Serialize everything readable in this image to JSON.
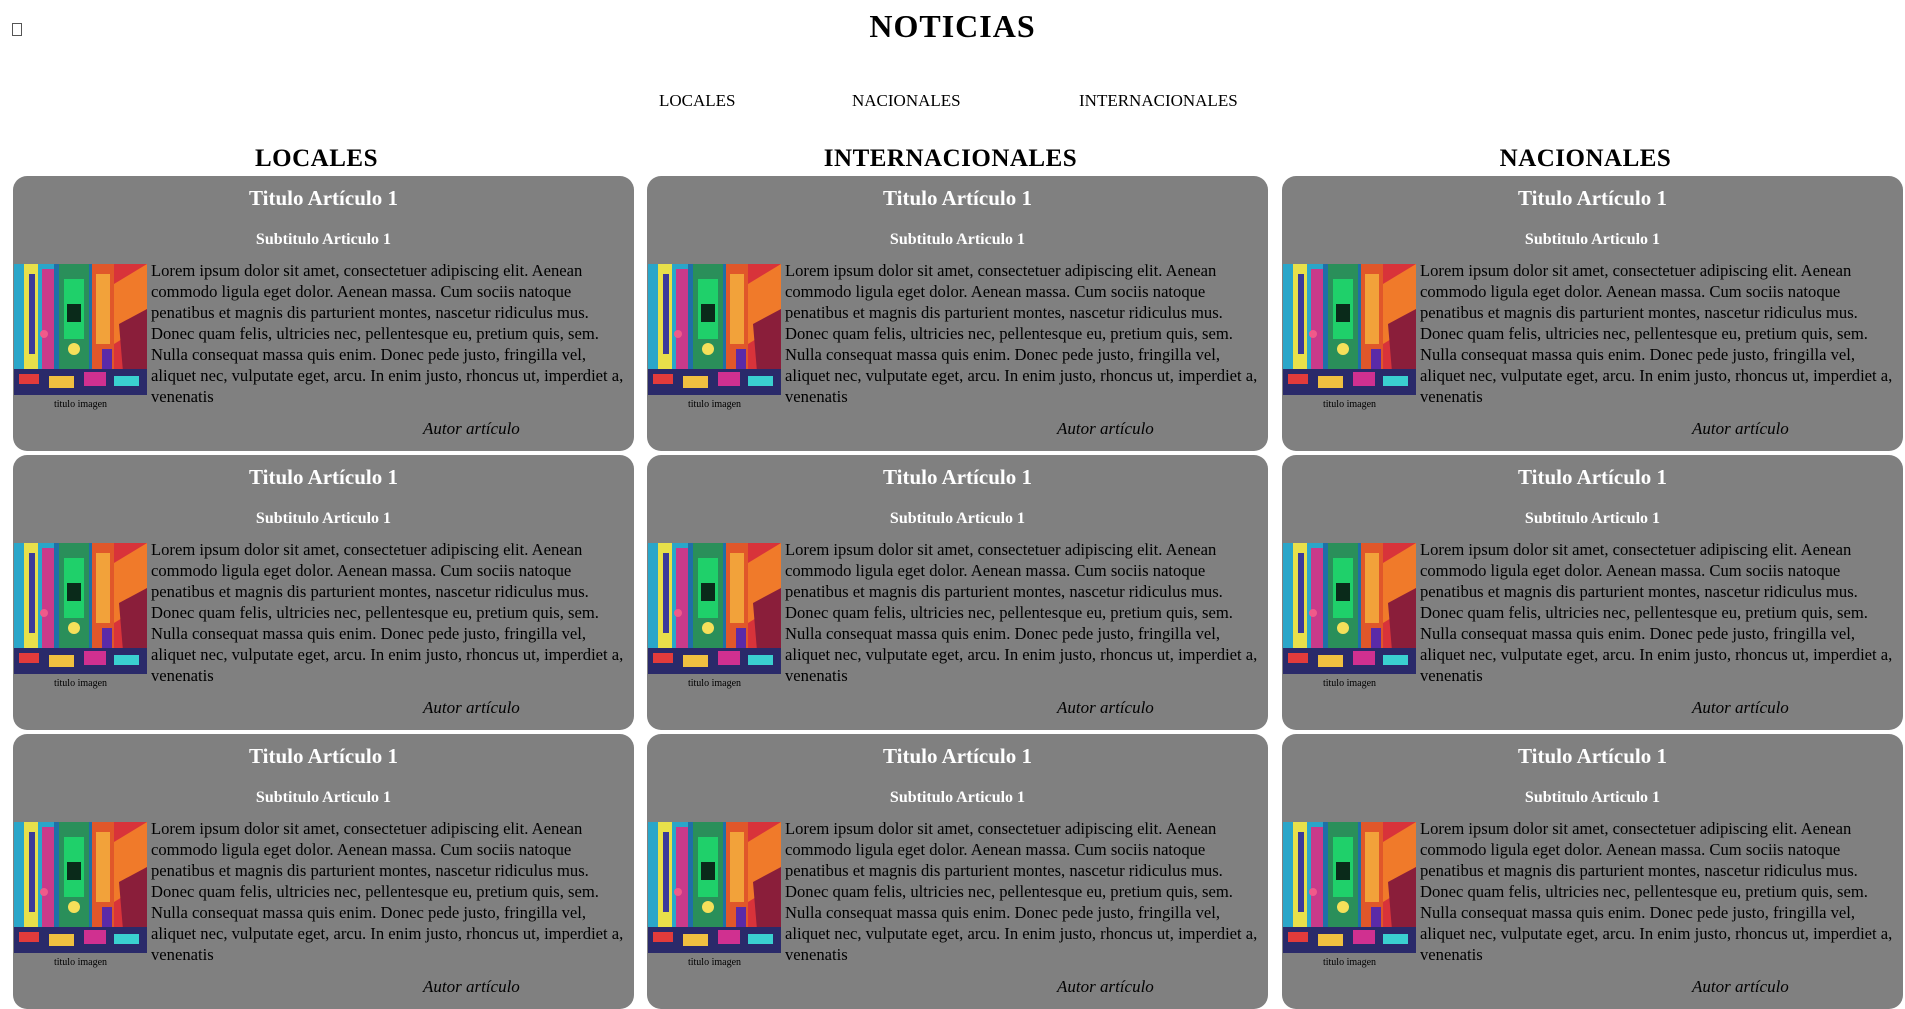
{
  "header": {
    "title": "NOTICIAS",
    "broken_image_icon": "broken-image-icon"
  },
  "nav": {
    "items": [
      {
        "label": "LOCALES"
      },
      {
        "label": "NACIONALES"
      },
      {
        "label": "INTERNACIONALES"
      }
    ]
  },
  "columns": [
    {
      "heading": "LOCALES",
      "articles": [
        {
          "title": "Titulo Artículo 1",
          "subtitle": "Subtitulo Articulo 1",
          "image_caption": "titulo imagen",
          "body": "Lorem ipsum dolor sit amet, consectetuer adipiscing elit. Aenean commodo ligula eget dolor. Aenean massa. Cum sociis natoque penatibus et magnis dis parturient montes, nascetur ridiculus mus. Donec quam felis, ultricies nec, pellentesque eu, pretium quis, sem. Nulla consequat massa quis enim. Donec pede justo, fringilla vel, aliquet nec, vulputate eget, arcu. In enim justo, rhoncus ut, imperdiet a, venenatis",
          "author": "Autor artículo"
        },
        {
          "title": "Titulo Artículo 1",
          "subtitle": "Subtitulo Articulo 1",
          "image_caption": "titulo imagen",
          "body": "Lorem ipsum dolor sit amet, consectetuer adipiscing elit. Aenean commodo ligula eget dolor. Aenean massa. Cum sociis natoque penatibus et magnis dis parturient montes, nascetur ridiculus mus. Donec quam felis, ultricies nec, pellentesque eu, pretium quis, sem. Nulla consequat massa quis enim. Donec pede justo, fringilla vel, aliquet nec, vulputate eget, arcu. In enim justo, rhoncus ut, imperdiet a, venenatis",
          "author": "Autor artículo"
        },
        {
          "title": "Titulo Artículo 1",
          "subtitle": "Subtitulo Articulo 1",
          "image_caption": "titulo imagen",
          "body": "Lorem ipsum dolor sit amet, consectetuer adipiscing elit. Aenean commodo ligula eget dolor. Aenean massa. Cum sociis natoque penatibus et magnis dis parturient montes, nascetur ridiculus mus. Donec quam felis, ultricies nec, pellentesque eu, pretium quis, sem. Nulla consequat massa quis enim. Donec pede justo, fringilla vel, aliquet nec, vulputate eget, arcu. In enim justo, rhoncus ut, imperdiet a, venenatis",
          "author": "Autor artículo"
        }
      ]
    },
    {
      "heading": "INTERNACIONALES",
      "articles": [
        {
          "title": "Titulo Artículo 1",
          "subtitle": "Subtitulo Articulo 1",
          "image_caption": "titulo imagen",
          "body": "Lorem ipsum dolor sit amet, consectetuer adipiscing elit. Aenean commodo ligula eget dolor. Aenean massa. Cum sociis natoque penatibus et magnis dis parturient montes, nascetur ridiculus mus. Donec quam felis, ultricies nec, pellentesque eu, pretium quis, sem. Nulla consequat massa quis enim. Donec pede justo, fringilla vel, aliquet nec, vulputate eget, arcu. In enim justo, rhoncus ut, imperdiet a, venenatis",
          "author": "Autor artículo"
        },
        {
          "title": "Titulo Artículo 1",
          "subtitle": "Subtitulo Articulo 1",
          "image_caption": "titulo imagen",
          "body": "Lorem ipsum dolor sit amet, consectetuer adipiscing elit. Aenean commodo ligula eget dolor. Aenean massa. Cum sociis natoque penatibus et magnis dis parturient montes, nascetur ridiculus mus. Donec quam felis, ultricies nec, pellentesque eu, pretium quis, sem. Nulla consequat massa quis enim. Donec pede justo, fringilla vel, aliquet nec, vulputate eget, arcu. In enim justo, rhoncus ut, imperdiet a, venenatis",
          "author": "Autor artículo"
        },
        {
          "title": "Titulo Artículo 1",
          "subtitle": "Subtitulo Articulo 1",
          "image_caption": "titulo imagen",
          "body": "Lorem ipsum dolor sit amet, consectetuer adipiscing elit. Aenean commodo ligula eget dolor. Aenean massa. Cum sociis natoque penatibus et magnis dis parturient montes, nascetur ridiculus mus. Donec quam felis, ultricies nec, pellentesque eu, pretium quis, sem. Nulla consequat massa quis enim. Donec pede justo, fringilla vel, aliquet nec, vulputate eget, arcu. In enim justo, rhoncus ut, imperdiet a, venenatis",
          "author": "Autor artículo"
        }
      ]
    },
    {
      "heading": "NACIONALES",
      "articles": [
        {
          "title": "Titulo Artículo 1",
          "subtitle": "Subtitulo Articulo 1",
          "image_caption": "titulo imagen",
          "body": "Lorem ipsum dolor sit amet, consectetuer adipiscing elit. Aenean commodo ligula eget dolor. Aenean massa. Cum sociis natoque penatibus et magnis dis parturient montes, nascetur ridiculus mus. Donec quam felis, ultricies nec, pellentesque eu, pretium quis, sem. Nulla consequat massa quis enim. Donec pede justo, fringilla vel, aliquet nec, vulputate eget, arcu. In enim justo, rhoncus ut, imperdiet a, venenatis",
          "author": "Autor artículo"
        },
        {
          "title": "Titulo Artículo 1",
          "subtitle": "Subtitulo Articulo 1",
          "image_caption": "titulo imagen",
          "body": "Lorem ipsum dolor sit amet, consectetuer adipiscing elit. Aenean commodo ligula eget dolor. Aenean massa. Cum sociis natoque penatibus et magnis dis parturient montes, nascetur ridiculus mus. Donec quam felis, ultricies nec, pellentesque eu, pretium quis, sem. Nulla consequat massa quis enim. Donec pede justo, fringilla vel, aliquet nec, vulputate eget, arcu. In enim justo, rhoncus ut, imperdiet a, venenatis",
          "author": "Autor artículo"
        },
        {
          "title": "Titulo Artículo 1",
          "subtitle": "Subtitulo Articulo 1",
          "image_caption": "titulo imagen",
          "body": "Lorem ipsum dolor sit amet, consectetuer adipiscing elit. Aenean commodo ligula eget dolor. Aenean massa. Cum sociis natoque penatibus et magnis dis parturient montes, nascetur ridiculus mus. Donec quam felis, ultricies nec, pellentesque eu, pretium quis, sem. Nulla consequat massa quis enim. Donec pede justo, fringilla vel, aliquet nec, vulputate eget, arcu. In enim justo, rhoncus ut, imperdiet a, venenatis",
          "author": "Autor artículo"
        }
      ]
    }
  ],
  "colors": {
    "card_background": "#808080",
    "card_title": "#ffffff",
    "page_background": "#ffffff"
  }
}
